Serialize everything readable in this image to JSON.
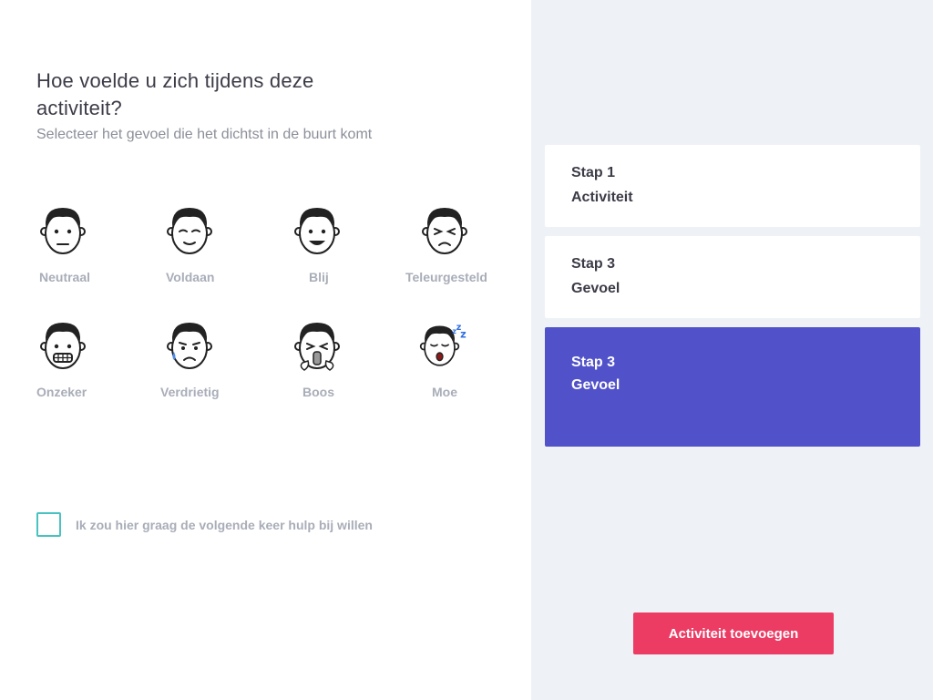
{
  "question": {
    "title": "Hoe voelde u zich tijdens deze activiteit?",
    "subtitle": "Selecteer het gevoel die het dichtst in de buurt komt"
  },
  "emotions": [
    {
      "label": "Neutraal",
      "icon": "neutral-face-icon"
    },
    {
      "label": "Voldaan",
      "icon": "satisfied-face-icon"
    },
    {
      "label": "Blij",
      "icon": "happy-face-icon"
    },
    {
      "label": "Teleurgesteld",
      "icon": "disappointed-face-icon"
    },
    {
      "label": "Onzeker",
      "icon": "grimacing-face-icon"
    },
    {
      "label": "Verdrietig",
      "icon": "crying-face-icon"
    },
    {
      "label": "Boos",
      "icon": "angry-face-icon"
    },
    {
      "label": "Moe",
      "icon": "sleepy-face-icon"
    }
  ],
  "checkbox": {
    "label": "Ik zou hier graag de volgende keer hulp bij willen",
    "checked": false
  },
  "steps": [
    {
      "title": "Stap 1",
      "name": "Activiteit",
      "active": false
    },
    {
      "title": "Stap 3",
      "name": "Gevoel",
      "active": false
    },
    {
      "title": "Stap 3",
      "name": "Gevoel",
      "active": true
    }
  ],
  "add_button": {
    "label": "Activiteit toevoegen"
  },
  "colors": {
    "accent": "#5152c9",
    "button": "#ec3c64",
    "checkbox_border": "#49c2c2",
    "right_bg": "#eef1f6"
  }
}
